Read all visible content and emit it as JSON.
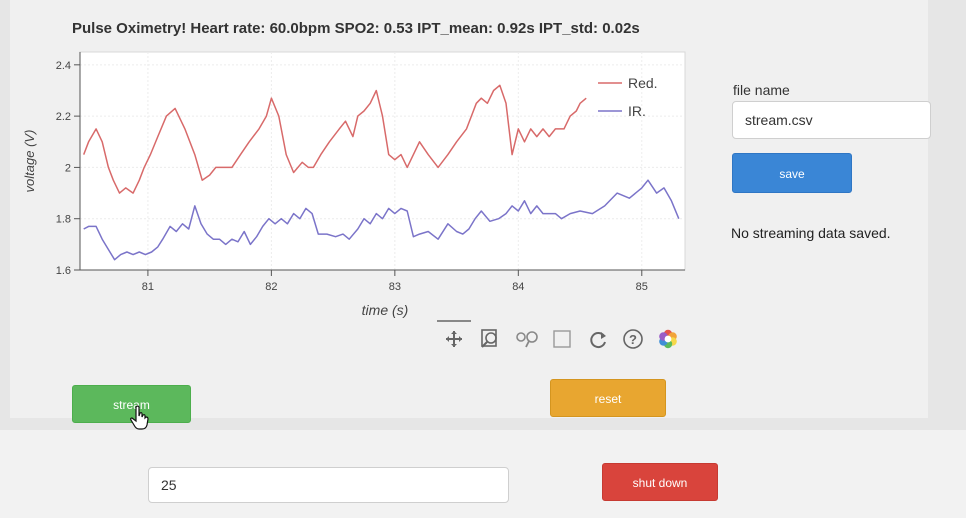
{
  "plot": {
    "title": "Pulse Oximetry! Heart rate: 60.0bpm  SPO2: 0.53  IPT_mean: 0.92s  IPT_std: 0.02s"
  },
  "chart_data": {
    "type": "line",
    "xlabel": "time (s)",
    "ylabel": "voltage (V)",
    "xlim": [
      80.45,
      85.35
    ],
    "ylim": [
      1.6,
      2.45
    ],
    "xticks": [
      "81",
      "82",
      "83",
      "84",
      "85"
    ],
    "yticks": [
      "1.6",
      "1.8",
      "2",
      "2.2",
      "2.4"
    ],
    "grid": true,
    "legend_position": "top-right",
    "series": [
      {
        "name": "Red.",
        "color": "#d86a6a",
        "x": [
          80.48,
          80.52,
          80.58,
          80.63,
          80.68,
          80.72,
          80.77,
          80.82,
          80.88,
          80.93,
          80.97,
          81.02,
          81.08,
          81.15,
          81.22,
          81.3,
          81.38,
          81.44,
          81.5,
          81.55,
          81.62,
          81.68,
          81.75,
          81.82,
          81.9,
          81.96,
          82.0,
          82.06,
          82.12,
          82.18,
          82.25,
          82.3,
          82.34,
          82.4,
          82.47,
          82.55,
          82.6,
          82.66,
          82.7,
          82.75,
          82.8,
          82.85,
          82.9,
          82.95,
          83.0,
          83.05,
          83.1,
          83.15,
          83.2,
          83.27,
          83.35,
          83.43,
          83.5,
          83.58,
          83.62,
          83.66,
          83.7,
          83.75,
          83.8,
          83.85,
          83.9,
          83.95,
          84.0,
          84.05,
          84.1,
          84.15,
          84.2,
          84.25,
          84.3,
          84.37,
          84.42,
          84.47,
          84.5,
          84.55
        ],
        "values": [
          2.05,
          2.1,
          2.15,
          2.1,
          2.0,
          1.95,
          1.9,
          1.92,
          1.9,
          1.95,
          2.0,
          2.05,
          2.12,
          2.2,
          2.23,
          2.15,
          2.05,
          1.95,
          1.97,
          2.0,
          2.0,
          2.0,
          2.05,
          2.1,
          2.15,
          2.2,
          2.27,
          2.2,
          2.05,
          1.98,
          2.02,
          2.0,
          2.0,
          2.05,
          2.1,
          2.15,
          2.18,
          2.12,
          2.2,
          2.22,
          2.25,
          2.3,
          2.2,
          2.05,
          2.03,
          2.05,
          2.0,
          2.05,
          2.1,
          2.05,
          2.0,
          2.05,
          2.1,
          2.15,
          2.2,
          2.25,
          2.27,
          2.25,
          2.3,
          2.32,
          2.25,
          2.05,
          2.15,
          2.1,
          2.15,
          2.12,
          2.15,
          2.12,
          2.15,
          2.15,
          2.2,
          2.22,
          2.25,
          2.27
        ]
      },
      {
        "name": "IR.",
        "color": "#7b74c9",
        "x": [
          80.48,
          80.52,
          80.58,
          80.63,
          80.68,
          80.73,
          80.78,
          80.83,
          80.88,
          80.93,
          80.98,
          81.03,
          81.08,
          81.12,
          81.18,
          81.23,
          81.28,
          81.33,
          81.38,
          81.43,
          81.48,
          81.53,
          81.58,
          81.63,
          81.68,
          81.73,
          81.78,
          81.83,
          81.88,
          81.93,
          81.98,
          82.03,
          82.08,
          82.13,
          82.18,
          82.23,
          82.28,
          82.33,
          82.38,
          82.45,
          82.52,
          82.58,
          82.63,
          82.7,
          82.75,
          82.8,
          82.85,
          82.9,
          82.95,
          83.0,
          83.05,
          83.1,
          83.15,
          83.2,
          83.27,
          83.35,
          83.43,
          83.5,
          83.55,
          83.6,
          83.65,
          83.7,
          83.77,
          83.84,
          83.9,
          83.95,
          84.0,
          84.05,
          84.1,
          84.15,
          84.2,
          84.25,
          84.3,
          84.35,
          84.42,
          84.5,
          84.6,
          84.7,
          84.8,
          84.9,
          85.0,
          85.05,
          85.12,
          85.18,
          85.24,
          85.3
        ],
        "values": [
          1.76,
          1.77,
          1.77,
          1.72,
          1.68,
          1.64,
          1.66,
          1.67,
          1.66,
          1.67,
          1.66,
          1.67,
          1.69,
          1.72,
          1.77,
          1.75,
          1.78,
          1.76,
          1.85,
          1.78,
          1.74,
          1.72,
          1.72,
          1.7,
          1.72,
          1.71,
          1.75,
          1.7,
          1.73,
          1.77,
          1.8,
          1.78,
          1.8,
          1.78,
          1.82,
          1.8,
          1.84,
          1.82,
          1.74,
          1.74,
          1.73,
          1.74,
          1.72,
          1.76,
          1.8,
          1.78,
          1.82,
          1.8,
          1.84,
          1.82,
          1.84,
          1.83,
          1.73,
          1.74,
          1.75,
          1.72,
          1.78,
          1.75,
          1.74,
          1.76,
          1.8,
          1.83,
          1.79,
          1.8,
          1.82,
          1.85,
          1.83,
          1.87,
          1.82,
          1.85,
          1.82,
          1.82,
          1.82,
          1.8,
          1.82,
          1.83,
          1.82,
          1.85,
          1.9,
          1.88,
          1.92,
          1.95,
          1.9,
          1.92,
          1.87,
          1.8
        ]
      }
    ]
  },
  "toolbar": {
    "tools": [
      "pan",
      "box-zoom",
      "wheel-zoom",
      "save",
      "reset",
      "help",
      "bokeh-logo"
    ]
  },
  "controls": {
    "stream_label": "stream",
    "reset_label": "reset",
    "shutdown_label": "shut down",
    "save_label": "save",
    "file_name_label": "file name",
    "file_name_value": "stream.csv",
    "count_value": "25",
    "status_text": "No streaming data saved."
  },
  "colors": {
    "stream": "#5cb85c",
    "reset": "#e8a630",
    "shutdown": "#d9443c",
    "save": "#3a86d6"
  }
}
